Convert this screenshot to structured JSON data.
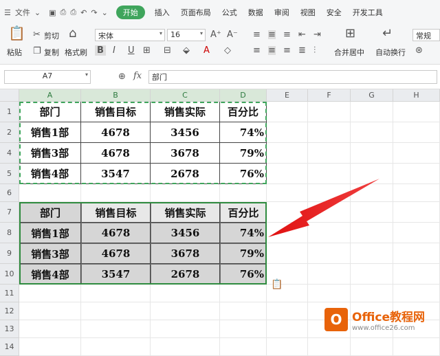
{
  "menu": {
    "file": "文件",
    "items": [
      "开始",
      "插入",
      "页面布局",
      "公式",
      "数据",
      "审阅",
      "视图",
      "安全",
      "开发工具"
    ],
    "active": "开始"
  },
  "ribbon": {
    "cut": "剪切",
    "copy": "复制",
    "paste": "粘贴",
    "format_painter": "格式刷",
    "font": "宋体",
    "size": "16",
    "merge": "合并居中",
    "wrap": "自动换行",
    "number_format": "常规"
  },
  "formula_bar": {
    "name_box": "A7",
    "fx": "fx",
    "content": "部门"
  },
  "columns": [
    "A",
    "B",
    "C",
    "D",
    "E",
    "F",
    "G",
    "H"
  ],
  "rows": [
    "1",
    "2",
    "4",
    "5",
    "6",
    "7",
    "8",
    "9",
    "10",
    "11",
    "12",
    "13",
    "14"
  ],
  "table1": {
    "header": [
      "部门",
      "销售目标",
      "销售实际",
      "百分比"
    ],
    "rows": [
      [
        "销售1部",
        "4678",
        "3456",
        "74%"
      ],
      [
        "销售3部",
        "4678",
        "3678",
        "79%"
      ],
      [
        "销售4部",
        "3547",
        "2678",
        "76%"
      ]
    ]
  },
  "table2": {
    "header": [
      "部门",
      "销售目标",
      "销售实际",
      "百分比"
    ],
    "rows": [
      [
        "销售1部",
        "4678",
        "3456",
        "74%"
      ],
      [
        "销售3部",
        "4678",
        "3678",
        "79%"
      ],
      [
        "销售4部",
        "3547",
        "2678",
        "76%"
      ]
    ]
  },
  "watermark": {
    "brand": "Office教程网",
    "url": "www.office26.com"
  }
}
